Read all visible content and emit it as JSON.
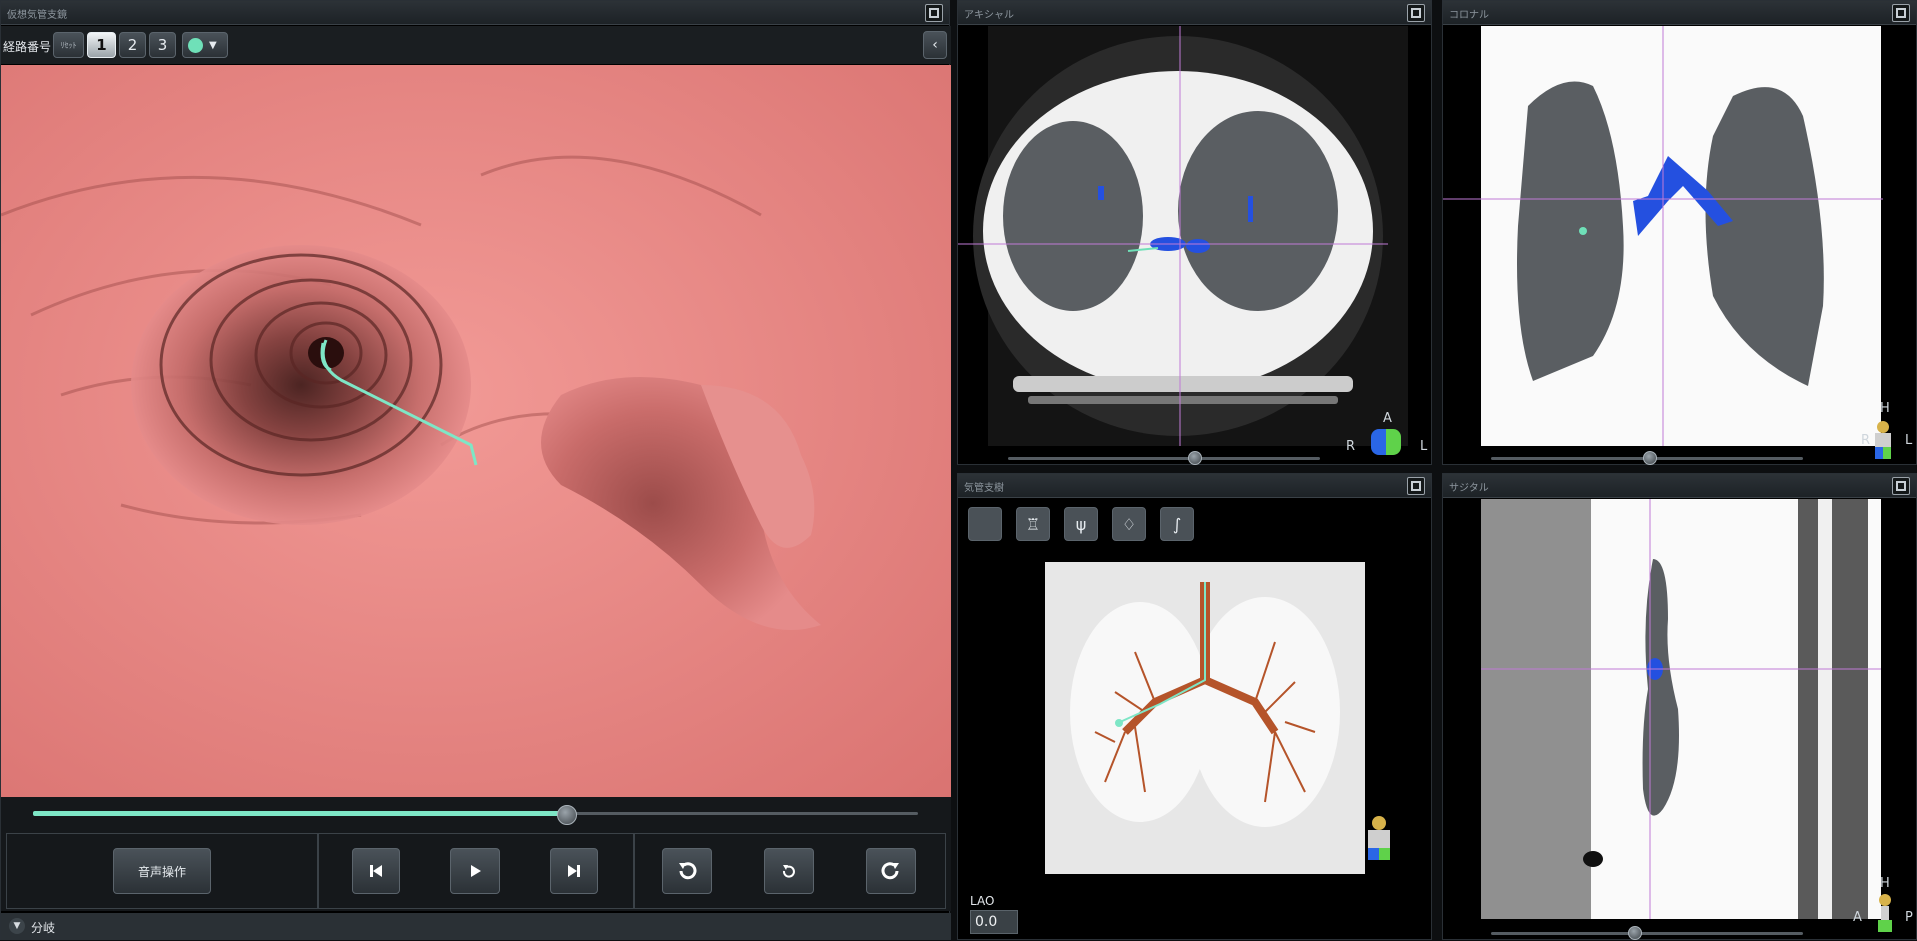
{
  "left_panel": {
    "title": "仮想気管支鏡",
    "route_label": "経路番号",
    "reset_label": "ﾘｾｯﾄ",
    "route_numbers": [
      "1",
      "2",
      "3"
    ],
    "selected_route": "1",
    "color_swatch": "#6fe0b8",
    "collapse_icon": "chevron-left-icon",
    "progress_fraction": 0.6,
    "voice_button": "音声操作",
    "bottom_label": "分岐"
  },
  "axial": {
    "title": "アキシャル",
    "orient_top": "A",
    "orient_left": "R",
    "orient_right": "L",
    "slider_fraction": 0.6
  },
  "coronal": {
    "title": "コロナル",
    "orient_top": "H",
    "orient_left": "R",
    "orient_right": "L",
    "slider_fraction": 0.45
  },
  "tree": {
    "title": "気管支樹",
    "view_label": "LAO",
    "view_value": "0.0",
    "tools": [
      "cube-view-icon",
      "chest-ap-icon",
      "bronchus-icon",
      "lung-icon",
      "curve-icon"
    ]
  },
  "sagittal": {
    "title": "サジタル",
    "orient_top": "H",
    "orient_left": "A",
    "orient_right": "P",
    "slider_fraction": 0.38
  },
  "colors": {
    "airway": "#e58b8a",
    "bronchus_blue": "#2450e0",
    "path_green": "#6fe0b8",
    "tree_orange": "#b5542a"
  }
}
